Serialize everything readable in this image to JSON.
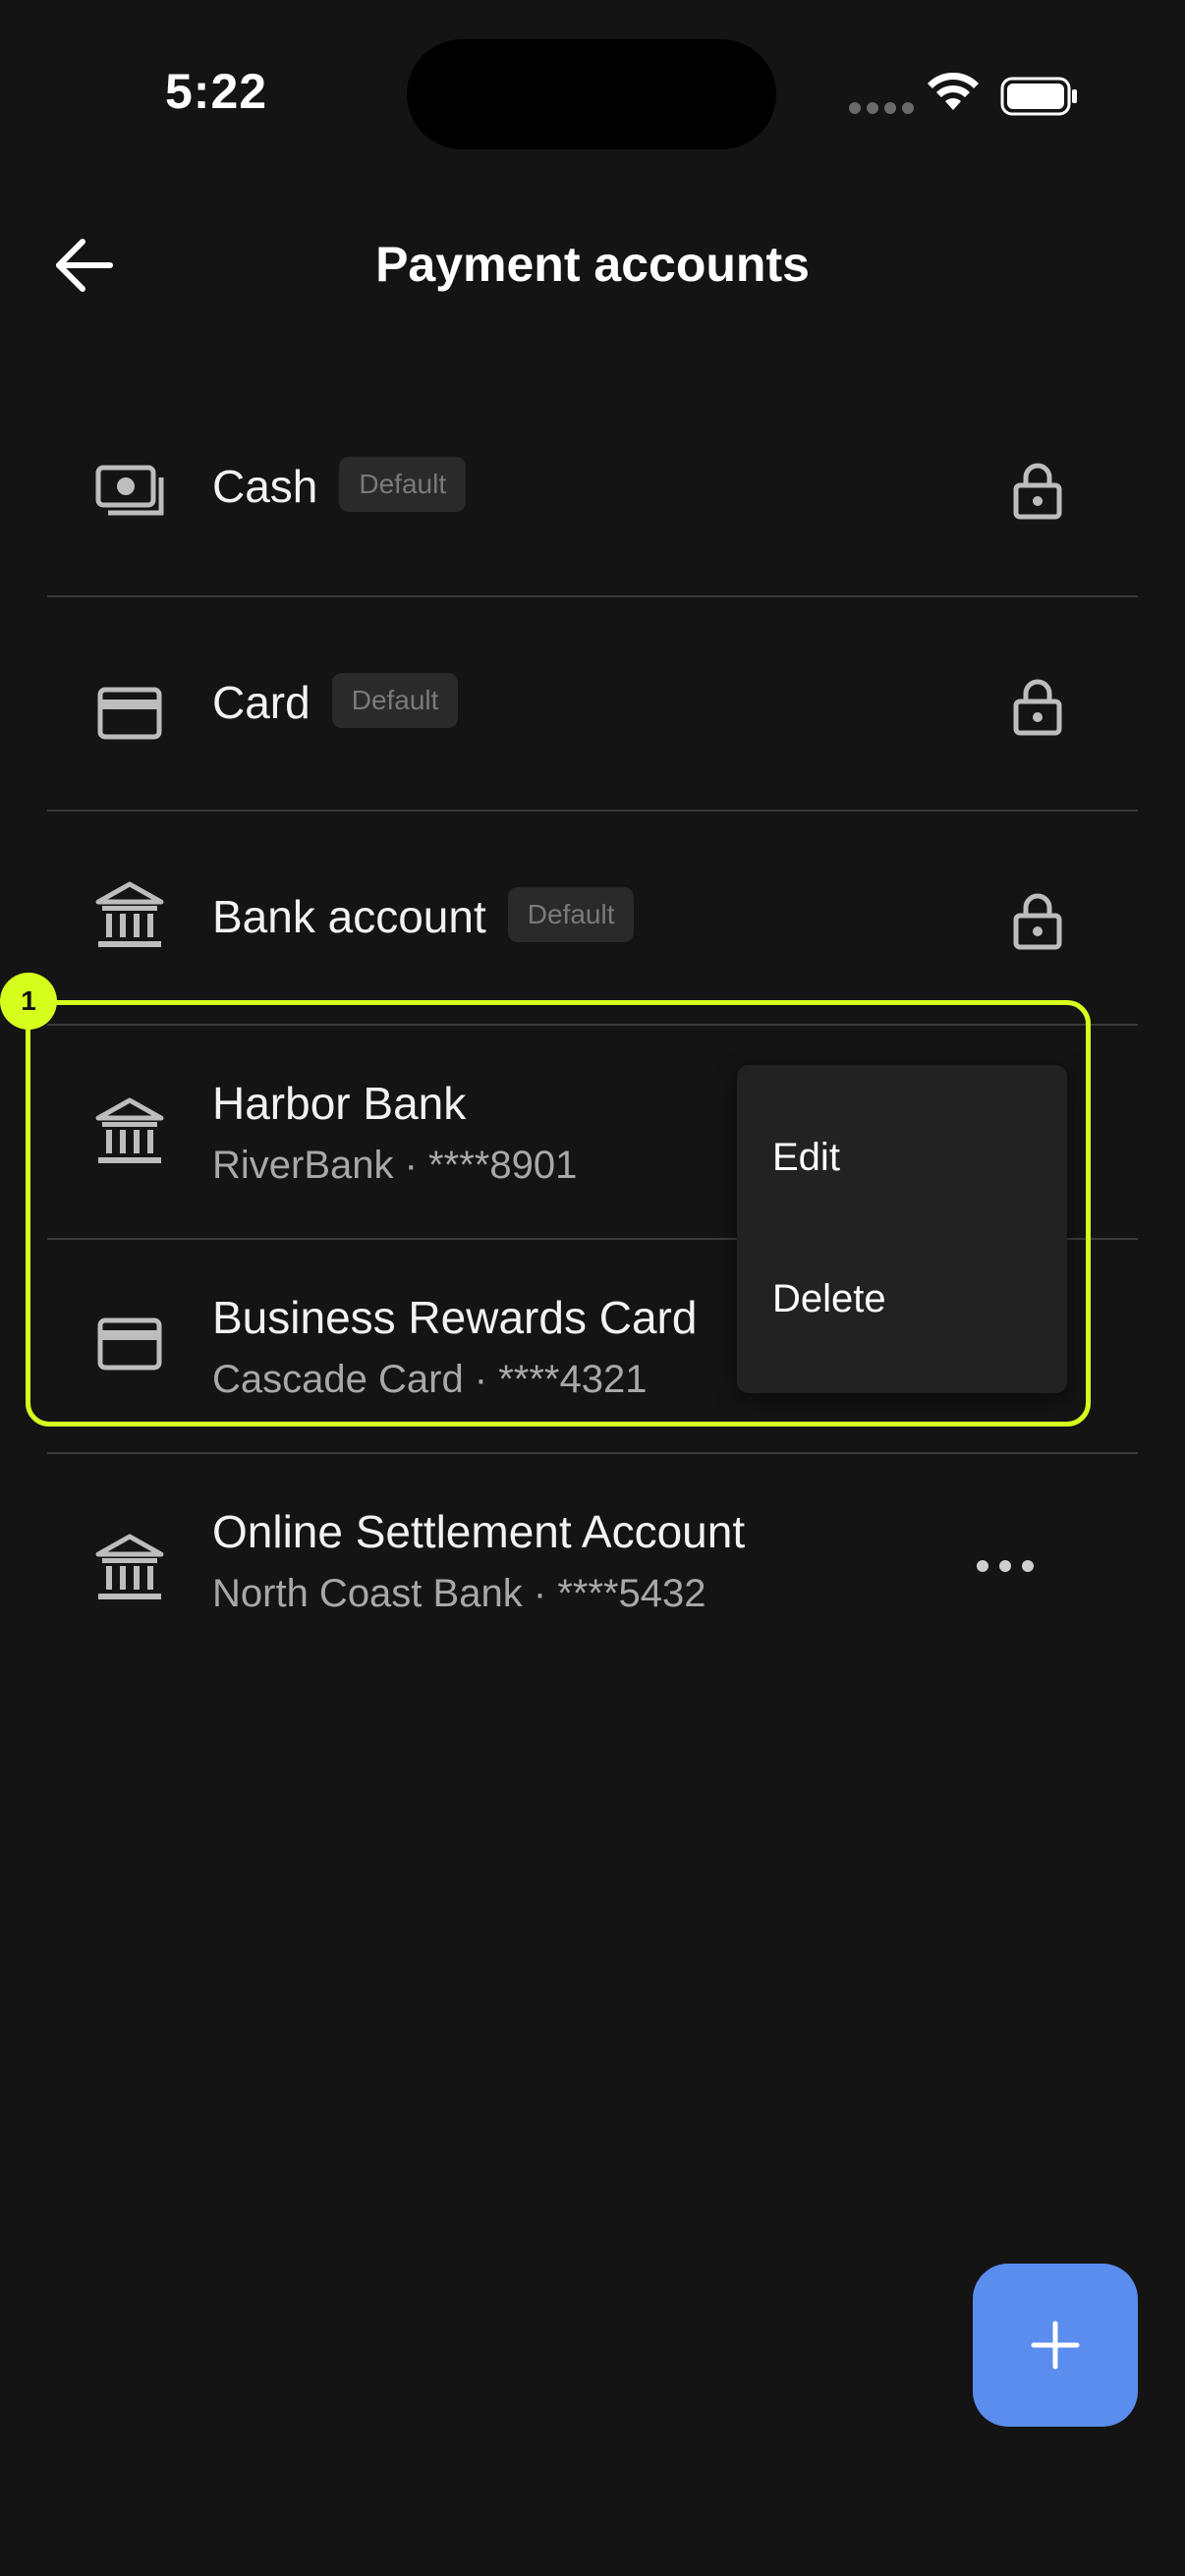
{
  "status_bar": {
    "time": "5:22"
  },
  "header": {
    "title": "Payment accounts"
  },
  "accounts": [
    {
      "title": "Cash",
      "badge": "Default",
      "icon": "cash-icon"
    },
    {
      "title": "Card",
      "badge": "Default",
      "icon": "card-icon"
    },
    {
      "title": "Bank account",
      "badge": "Default",
      "icon": "bank-icon"
    },
    {
      "title": "Harbor Bank",
      "subtitle": "RiverBank · ****8901",
      "icon": "bank-icon"
    },
    {
      "title": "Business Rewards Card",
      "subtitle": "Cascade Card · ****4321",
      "icon": "card-icon"
    },
    {
      "title": "Online Settlement Account",
      "subtitle": "North Coast Bank · ****5432",
      "icon": "bank-icon"
    }
  ],
  "context_menu": {
    "edit": "Edit",
    "delete": "Delete"
  },
  "highlight": {
    "label": "1",
    "color": "#d6ff1e"
  },
  "fab": {
    "icon": "plus-icon",
    "color": "#5b8def"
  }
}
